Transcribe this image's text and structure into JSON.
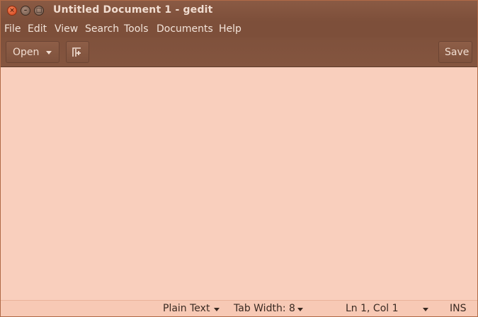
{
  "window": {
    "title": "Untitled Document 1 - gedit",
    "controls": {
      "close_glyph": "×",
      "minimize_glyph": "–",
      "maximize_glyph": "□"
    }
  },
  "menubar": {
    "items": [
      "File",
      "Edit",
      "View",
      "Search",
      "Tools",
      "Documents",
      "Help"
    ]
  },
  "toolbar": {
    "open_label": "Open",
    "new_tab_icon": "new-tab-icon",
    "save_label": "Save"
  },
  "editor": {
    "content": ""
  },
  "statusbar": {
    "language": "Plain Text",
    "tab_width": "Tab Width: 8",
    "position": "Ln 1, Col 1",
    "mode": "INS"
  },
  "colors": {
    "titlebar": "#7d4f3a",
    "editor_bg": "#f9cfbd",
    "close_button": "#e2542a"
  }
}
